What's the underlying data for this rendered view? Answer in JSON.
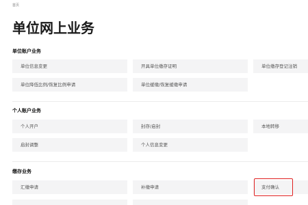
{
  "breadcrumb": "首页",
  "page_title": "单位网上业务",
  "sections": [
    {
      "title": "单位账户业务",
      "items": [
        "单位信息变更",
        "开具单位缴存证明",
        "单位缴存登记注销",
        "单位降低比例/恢复比例申请",
        "单位缓缴/恢复缓缴申请"
      ]
    },
    {
      "title": "个人账户业务",
      "items": [
        "个人开户",
        "封存/启封",
        "本地转移",
        "启封调整",
        "个人信息变更"
      ]
    },
    {
      "title": "缴存业务",
      "items": [
        "汇缴申请",
        "补缴申请",
        "支付确认"
      ]
    }
  ],
  "highlight_color": "#e02020",
  "tile_background": "#f4f4f5"
}
